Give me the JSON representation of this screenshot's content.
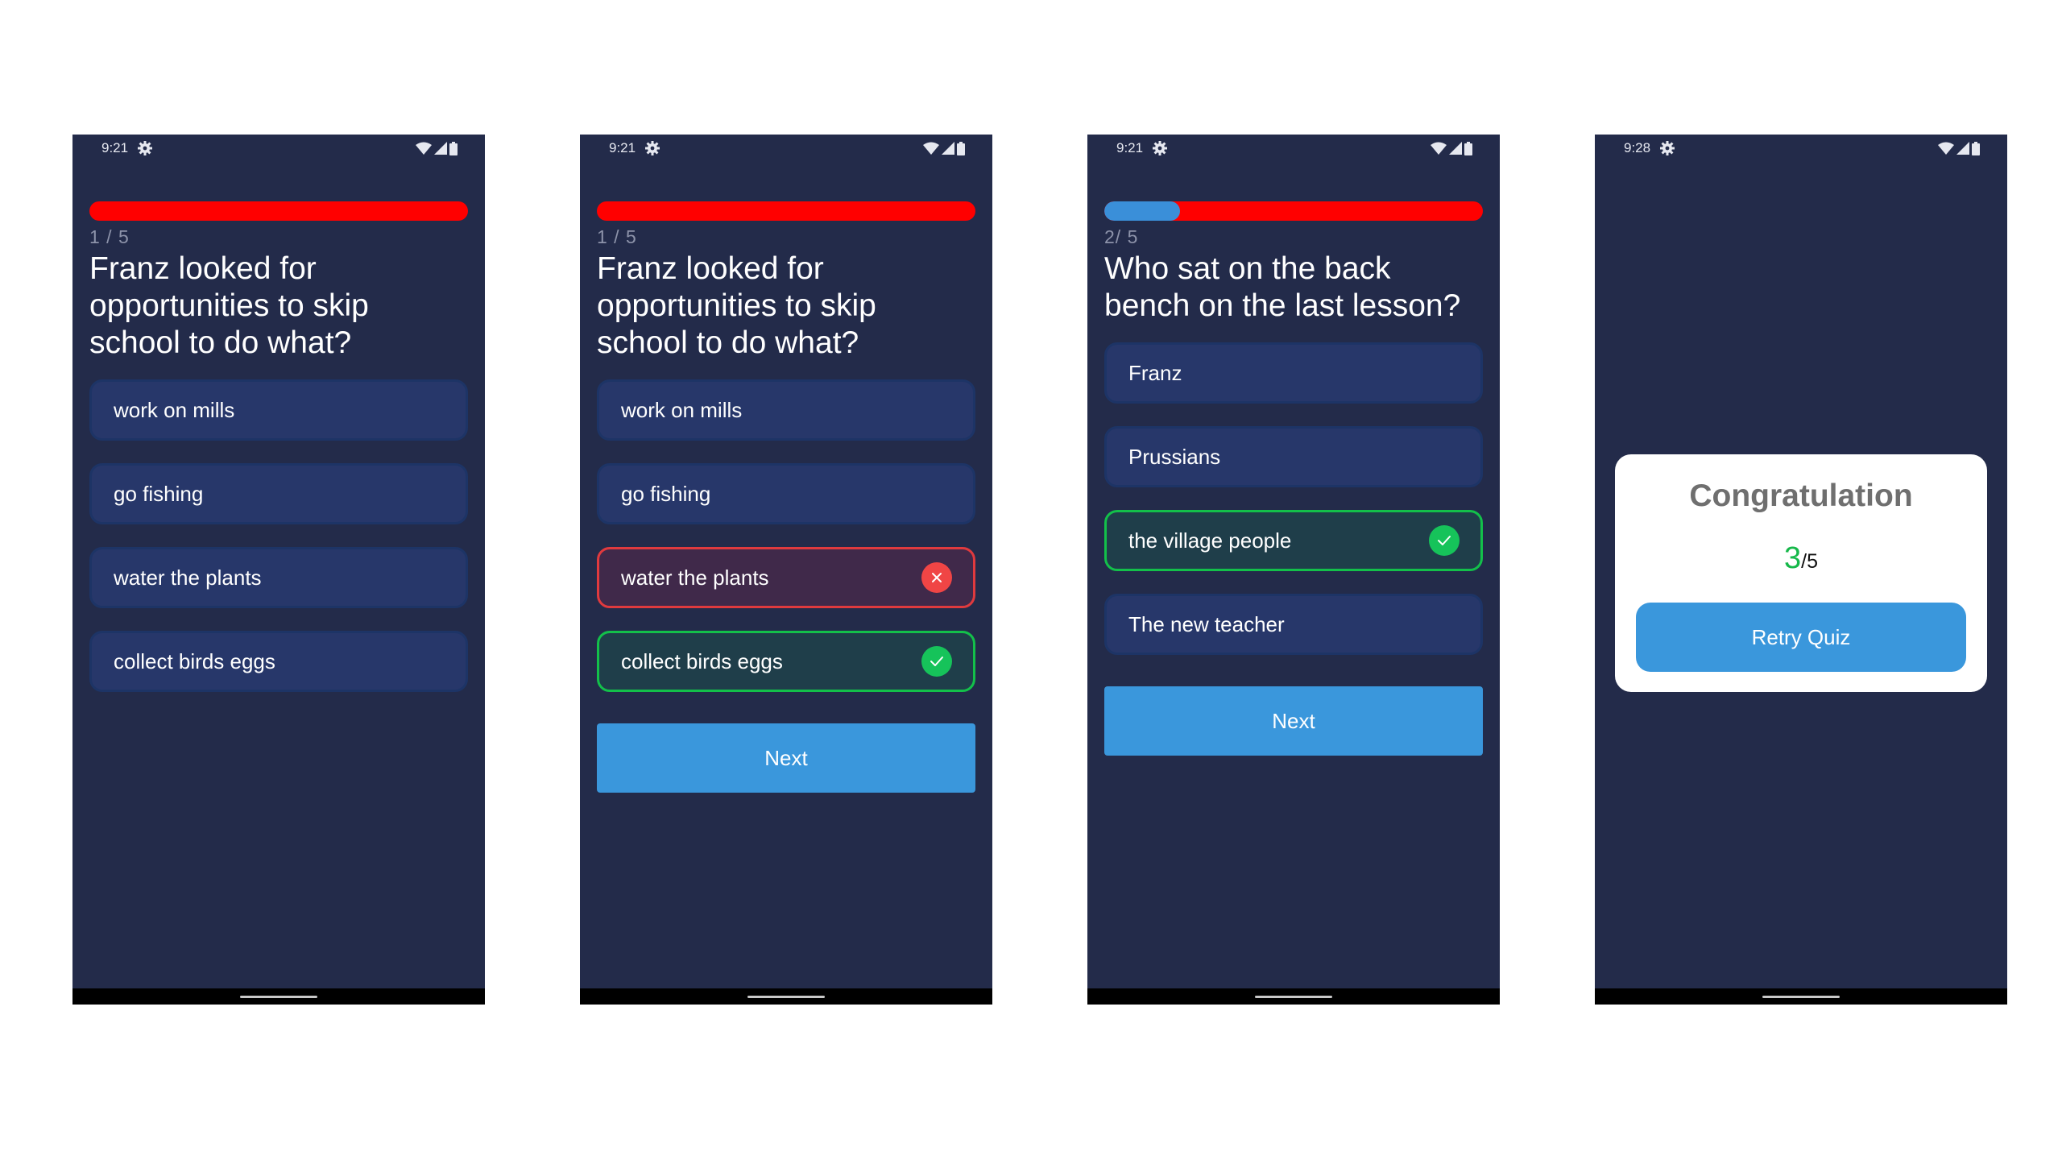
{
  "colors": {
    "background": "#232b4a",
    "option_bg": "#27376a",
    "progress_track": "#ff0000",
    "progress_fill": "#3a8fd9",
    "correct": "#16c35a",
    "wrong": "#f04545",
    "button": "#3a97dc"
  },
  "screens": [
    {
      "status": {
        "time": "9:21"
      },
      "progress": {
        "fraction": 0
      },
      "counter": "1 / 5",
      "question": "Franz looked for opportunities to skip school to do what?",
      "options": [
        {
          "label": "work on mills",
          "state": "default"
        },
        {
          "label": "go fishing",
          "state": "default"
        },
        {
          "label": "water the plants",
          "state": "default"
        },
        {
          "label": "collect birds eggs",
          "state": "default"
        }
      ]
    },
    {
      "status": {
        "time": "9:21"
      },
      "progress": {
        "fraction": 0
      },
      "counter": "1 / 5",
      "question": "Franz looked for opportunities to skip school to do what?",
      "options": [
        {
          "label": "work on mills",
          "state": "default"
        },
        {
          "label": "go fishing",
          "state": "default"
        },
        {
          "label": "water the plants",
          "state": "wrong",
          "icon": "close-icon"
        },
        {
          "label": "collect birds eggs",
          "state": "correct",
          "icon": "check-icon"
        }
      ],
      "next_label": "Next"
    },
    {
      "status": {
        "time": "9:21"
      },
      "progress": {
        "fraction": 0.2
      },
      "counter": "2/ 5",
      "question": "Who sat on the back bench on the last lesson?",
      "options": [
        {
          "label": "Franz",
          "state": "default"
        },
        {
          "label": "Prussians",
          "state": "default"
        },
        {
          "label": "the village people",
          "state": "correct",
          "icon": "check-icon"
        },
        {
          "label": "The new teacher",
          "state": "default"
        }
      ],
      "next_label": "Next"
    },
    {
      "status": {
        "time": "9:28"
      },
      "dialog": {
        "title": "Congratulation",
        "score": "3",
        "total": "/5",
        "retry_label": "Retry Quiz"
      }
    }
  ]
}
